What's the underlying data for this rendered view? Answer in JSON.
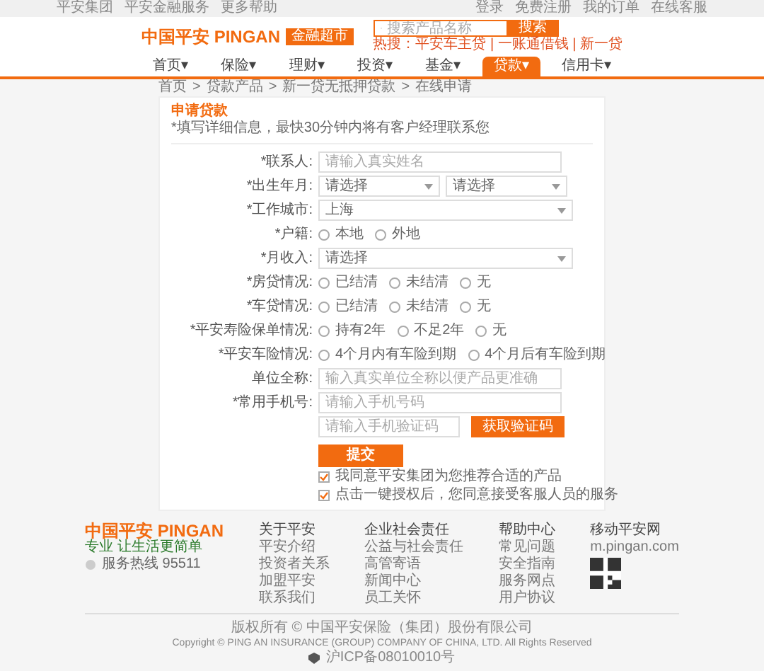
{
  "top_bar": {
    "left_links": [
      "平安集团",
      "平安金融服务",
      "更多帮助"
    ],
    "right_links": [
      "登录",
      "免费注册",
      "我的订单",
      "在线客服"
    ]
  },
  "header": {
    "logo": "中国平安 PINGAN",
    "badge": "金融超市",
    "search": {
      "placeholder": "搜索产品名称",
      "button": "搜索"
    },
    "hot_words": "热搜：平安车主贷 | 一账通借钱 | 新一贷"
  },
  "nav": [
    {
      "label": "首页",
      "selected": false
    },
    {
      "label": "保险",
      "selected": false
    },
    {
      "label": "理财",
      "selected": false
    },
    {
      "label": "投资",
      "selected": false
    },
    {
      "label": "基金",
      "selected": false
    },
    {
      "label": "贷款",
      "selected": true
    },
    {
      "label": "信用卡",
      "selected": false
    }
  ],
  "nav_caret": "▾",
  "breadcrumb": [
    "首页",
    "贷款产品",
    "新一贷无抵押贷款",
    "在线申请"
  ],
  "breadcrumb_separator": ">",
  "form": {
    "title": "申请贷款",
    "subtitle": "*填写详细信息，最快30分钟内将有客户经理联系您",
    "rows": [
      {
        "kind": "text",
        "label": "*联系人:",
        "placeholder": "请输入真实姓名"
      },
      {
        "kind": "select2",
        "label": "*出生年月:",
        "values": [
          "请选择",
          "请选择"
        ]
      },
      {
        "kind": "select",
        "label": "*工作城市:",
        "value": "上海"
      },
      {
        "kind": "radio",
        "label": "*户籍:",
        "options": [
          {
            "label": "本地",
            "selected": false
          },
          {
            "label": "外地",
            "selected": false
          }
        ]
      },
      {
        "kind": "select",
        "label": "*月收入:",
        "value": "请选择"
      },
      {
        "kind": "radio",
        "label": "*房贷情况:",
        "options": [
          {
            "label": "已结清",
            "selected": false
          },
          {
            "label": "未结清",
            "selected": false
          },
          {
            "label": "无",
            "selected": false
          }
        ]
      },
      {
        "kind": "radio",
        "label": "*车贷情况:",
        "options": [
          {
            "label": "已结清",
            "selected": false
          },
          {
            "label": "未结清",
            "selected": false
          },
          {
            "label": "无",
            "selected": false
          }
        ]
      },
      {
        "kind": "radio",
        "label": "*平安寿险保单情况:",
        "options": [
          {
            "label": "持有2年",
            "selected": false
          },
          {
            "label": "不足2年",
            "selected": false
          },
          {
            "label": "无",
            "selected": false
          }
        ]
      },
      {
        "kind": "radio",
        "label": "*平安车险情况:",
        "options": [
          {
            "label": "4个月内有车险到期",
            "selected": false
          },
          {
            "label": "4个月后有车险到期",
            "selected": false
          }
        ]
      },
      {
        "kind": "text",
        "label": "单位全称:",
        "placeholder": "输入真实单位全称以便产品更准确"
      },
      {
        "kind": "text",
        "label": "*常用手机号:",
        "placeholder": "请输入手机号码"
      },
      {
        "kind": "code",
        "placeholder": "请输入手机验证码",
        "button": "获取验证码"
      }
    ],
    "submit": "提交",
    "agreements": [
      {
        "text": "我同意平安集团为您推荐合适的产品",
        "checked": true
      },
      {
        "text": "点击一键授权后，您同意接受客服人员的服务",
        "checked": true
      }
    ]
  },
  "footer": {
    "logo": "中国平安 PINGAN",
    "slogan": "专业 让生活更简单",
    "hotline": "服务热线 95511",
    "columns": [
      {
        "title": "关于平安",
        "links": [
          "平安介绍",
          "投资者关系",
          "加盟平安",
          "联系我们"
        ]
      },
      {
        "title": "企业社会责任",
        "links": [
          "公益与社会责任",
          "高管寄语",
          "新闻中心",
          "员工关怀"
        ]
      },
      {
        "title": "帮助中心",
        "links": [
          "常见问题",
          "安全指南",
          "服务网点",
          "用户协议"
        ]
      },
      {
        "title": "移动平安网",
        "links": [
          "m.pingan.com"
        ]
      }
    ],
    "copyright": "版权所有 © 中国平安保险（集团）股份有限公司",
    "copyright_en": "Copyright © PING AN INSURANCE (GROUP) COMPANY OF CHINA, LTD. All Rights Reserved",
    "icp": "沪ICP备08010010号"
  }
}
